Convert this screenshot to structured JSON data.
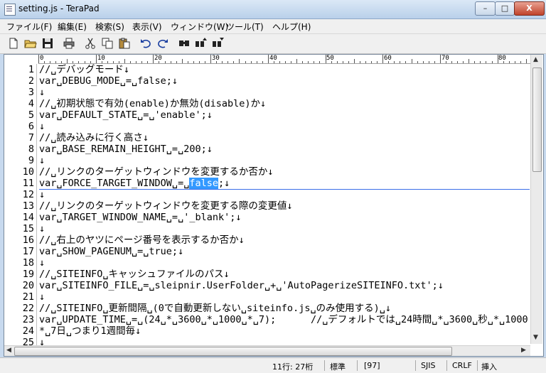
{
  "window": {
    "title": "setting.js - TeraPad",
    "minimize": "–",
    "maximize": "□",
    "close": "X"
  },
  "menu": [
    "ファイル(F)",
    "編集(E)",
    "検索(S)",
    "表示(V)",
    "ウィンドウ(W)",
    "ツール(T)",
    "ヘルプ(H)"
  ],
  "ruler": {
    "labels": [
      "0",
      "10",
      "20",
      "30",
      "40",
      "50",
      "60",
      "70",
      "80"
    ]
  },
  "editor": {
    "line_numbers": [
      "1",
      "2",
      "3",
      "4",
      "5",
      "6",
      "7",
      "8",
      "9",
      "10",
      "11",
      "12",
      "13",
      "14",
      "15",
      "16",
      "17",
      "18",
      "19",
      "20",
      "21",
      "22",
      "23",
      "24",
      "25"
    ],
    "lines": [
      "//␣デバッグモード↓",
      "var␣DEBUG_MODE␣=␣false;↓",
      "↓",
      "//␣初期状態で有効(enable)か無効(disable)か↓",
      "var␣DEFAULT_STATE␣=␣'enable';↓",
      "↓",
      "//␣読み込みに行く高さ↓",
      "var␣BASE_REMAIN_HEIGHT␣=␣200;↓",
      "↓",
      "//␣リンクのターゲットウィンドウを変更するか否か↓",
      "var␣FORCE_TARGET_WINDOW␣=␣",
      "↓",
      "//␣リンクのターゲットウィンドウを変更する際の変更値↓",
      "var␣TARGET_WINDOW_NAME␣=␣'_blank';↓",
      "↓",
      "//␣右上のヤツにページ番号を表示するか否か↓",
      "var␣SHOW_PAGENUM␣=␣true;↓",
      "↓",
      "//␣SITEINFO␣キャッシュファイルのパス↓",
      "var␣SITEINFO_FILE␣=␣sleipnir.UserFolder␣+␣'AutoPagerizeSITEINFO.txt';↓",
      "↓",
      "//␣SITEINFO␣更新間隔␣(0で自動更新しない␣siteinfo.js␣のみ使用する)␣↓",
      "var␣UPDATE_TIME␣=␣(24␣*␣3600␣*␣1000␣*␣7);      //␣デフォルトでは␣24時間␣*␣3600␣秒␣*␣1000",
      "*␣7日␣つまり1週間毎↓",
      "↓"
    ],
    "selected_text": "false",
    "after_selection": ";↓"
  },
  "status": {
    "position": "11行:  27桁",
    "mode": "標準",
    "code": "[97]",
    "encoding": "SJIS",
    "newline": "CRLF",
    "insert": "挿入"
  }
}
